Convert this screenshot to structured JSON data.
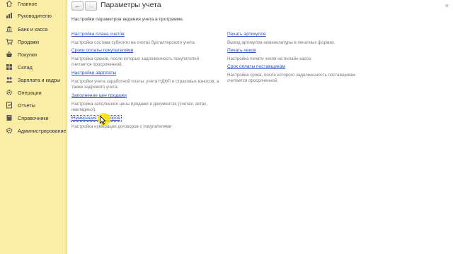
{
  "sidebar": {
    "items": [
      {
        "label": "Главное",
        "icon": "home-icon"
      },
      {
        "label": "Руководителю",
        "icon": "chart-icon"
      },
      {
        "label": "Банк и касса",
        "icon": "bank-icon"
      },
      {
        "label": "Продажи",
        "icon": "cart-icon"
      },
      {
        "label": "Покупки",
        "icon": "basket-icon"
      },
      {
        "label": "Склад",
        "icon": "warehouse-icon"
      },
      {
        "label": "Зарплата и кадры",
        "icon": "people-icon"
      },
      {
        "label": "Операции",
        "icon": "gear-icon"
      },
      {
        "label": "Отчеты",
        "icon": "report-icon"
      },
      {
        "label": "Справочники",
        "icon": "book-icon"
      },
      {
        "label": "Администрирование",
        "icon": "admin-gear-icon"
      }
    ]
  },
  "header": {
    "back_label": "←",
    "forward_label": "→",
    "title": "Параметры учета",
    "close_label": "×"
  },
  "main": {
    "subtitle": "Настройки параметров ведения учета в программе.",
    "left_settings": [
      {
        "link": "Настройка плана счетов",
        "desc": "Настройка состава субконто на счетах бухгалтерского учета."
      },
      {
        "link": "Сроки оплаты покупателями",
        "desc": "Настройка сроков, после которых задолженность покупателей считается просроченной."
      },
      {
        "link": "Настройки зарплаты",
        "desc": "Настройки учета заработной платы, учета НДФЛ и страховых взносов, а также кадрового учета."
      },
      {
        "link": "Заполнение цен продажи",
        "desc": "Настройка заполнения цены продажи в документах (счетах, актах, накладных)."
      },
      {
        "link": "Нумерация договоров",
        "desc": "Настройка нумерации договоров с покупателями"
      }
    ],
    "right_settings": [
      {
        "link": "Печать артикулов",
        "desc": "Вывод артикулов номенклатуры в печатных формах."
      },
      {
        "link": "Печать чеков",
        "desc": "Настройка печати чеков на онлайн кассе."
      },
      {
        "link": "Срок оплаты поставщикам",
        "desc": "Настройка срока, после которого задолженность поставщикам считается просроченной."
      }
    ]
  },
  "colors": {
    "sidebar_bg": "#fbeda6",
    "link": "#2a52be",
    "cursor_halo": "#ffe600"
  }
}
